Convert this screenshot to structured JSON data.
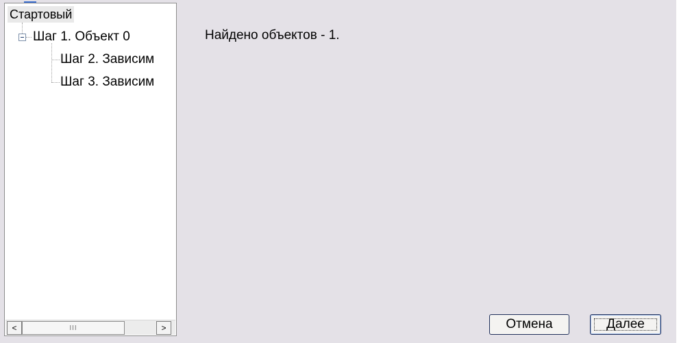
{
  "tree": {
    "root_label": "Стартовый",
    "nodes": [
      {
        "label": "Шаг 1. Объект 0"
      },
      {
        "label": "Шаг 2. Зависим"
      },
      {
        "label": "Шаг 3. Зависим"
      }
    ],
    "scrollbar": {
      "left_arrow": "<",
      "right_arrow": ">",
      "thumb_grip": "III"
    }
  },
  "content": {
    "message": "Найдено объектов - 1."
  },
  "buttons": {
    "cancel_label": "Отмена",
    "next_label": "Далее"
  }
}
